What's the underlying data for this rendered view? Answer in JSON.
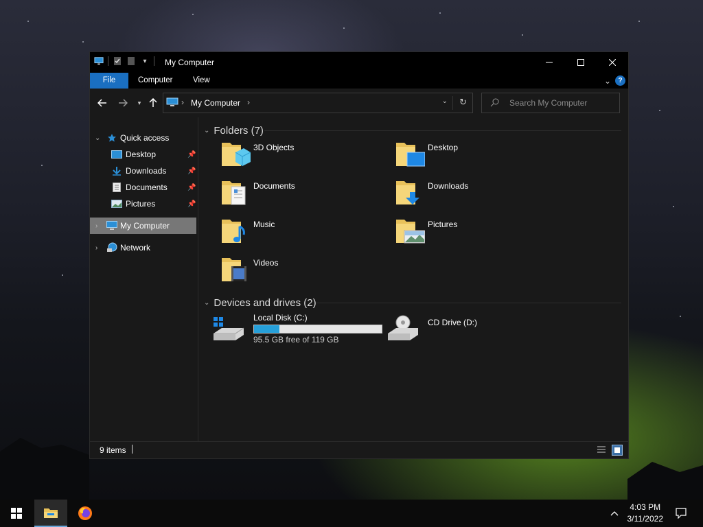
{
  "window": {
    "title": "My Computer",
    "controls": {
      "minimize": "minimize",
      "maximize": "maximize",
      "close": "close"
    }
  },
  "ribbon": {
    "tabs": [
      {
        "label": "File"
      },
      {
        "label": "Computer"
      },
      {
        "label": "View"
      }
    ]
  },
  "address": {
    "location": "My Computer"
  },
  "search": {
    "placeholder": "Search My Computer"
  },
  "sidebar": {
    "quick_access": "Quick access",
    "quick_items": [
      {
        "label": "Desktop",
        "icon": "desktop-icon",
        "pinned": true
      },
      {
        "label": "Downloads",
        "icon": "downloads-icon",
        "pinned": true
      },
      {
        "label": "Documents",
        "icon": "documents-icon",
        "pinned": true
      },
      {
        "label": "Pictures",
        "icon": "pictures-icon",
        "pinned": true
      }
    ],
    "my_computer": "My Computer",
    "network": "Network"
  },
  "content": {
    "folders_header": "Folders (7)",
    "folders": [
      {
        "label": "3D Objects",
        "icon": "3d-objects-folder-icon"
      },
      {
        "label": "Desktop",
        "icon": "desktop-folder-icon"
      },
      {
        "label": "Documents",
        "icon": "documents-folder-icon"
      },
      {
        "label": "Downloads",
        "icon": "downloads-folder-icon"
      },
      {
        "label": "Music",
        "icon": "music-folder-icon"
      },
      {
        "label": "Pictures",
        "icon": "pictures-folder-icon"
      },
      {
        "label": "Videos",
        "icon": "videos-folder-icon"
      }
    ],
    "devices_header": "Devices and drives (2)",
    "drives": [
      {
        "label": "Local Disk (C:)",
        "free_text": "95.5 GB free of 119 GB",
        "used_fraction": 0.197,
        "icon": "local-disk-icon"
      },
      {
        "label": "CD Drive (D:)",
        "icon": "cd-drive-icon"
      }
    ]
  },
  "status": {
    "items": "9 items"
  },
  "taskbar": {
    "time": "4:03 PM",
    "date": "3/11/2022"
  },
  "colors": {
    "accent": "#1a6fc1",
    "drive_fill": "#26a0da",
    "selected": "#777777"
  }
}
